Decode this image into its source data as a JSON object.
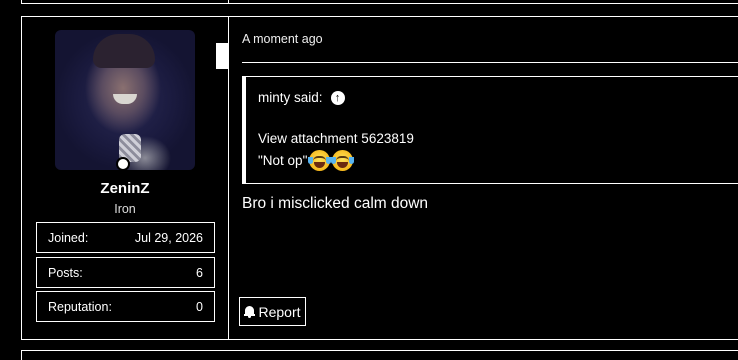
{
  "user": {
    "username": "ZeninZ",
    "rank": "Iron",
    "stats": [
      {
        "label": "Joined:",
        "value": "Jul 29, 2026"
      },
      {
        "label": "Posts:",
        "value": "6"
      },
      {
        "label": "Reputation:",
        "value": "0"
      }
    ]
  },
  "post": {
    "time": "A moment ago",
    "quote": {
      "author": "minty said:",
      "attachment": "View attachment 5623819",
      "text": "\"Not op\""
    },
    "message": "Bro i misclicked calm down",
    "report_label": "Report"
  },
  "icons": {
    "quote_jump": "arrow-up-circle-icon",
    "report": "bell-icon",
    "emoji": "face-with-tears-of-joy-icon"
  }
}
